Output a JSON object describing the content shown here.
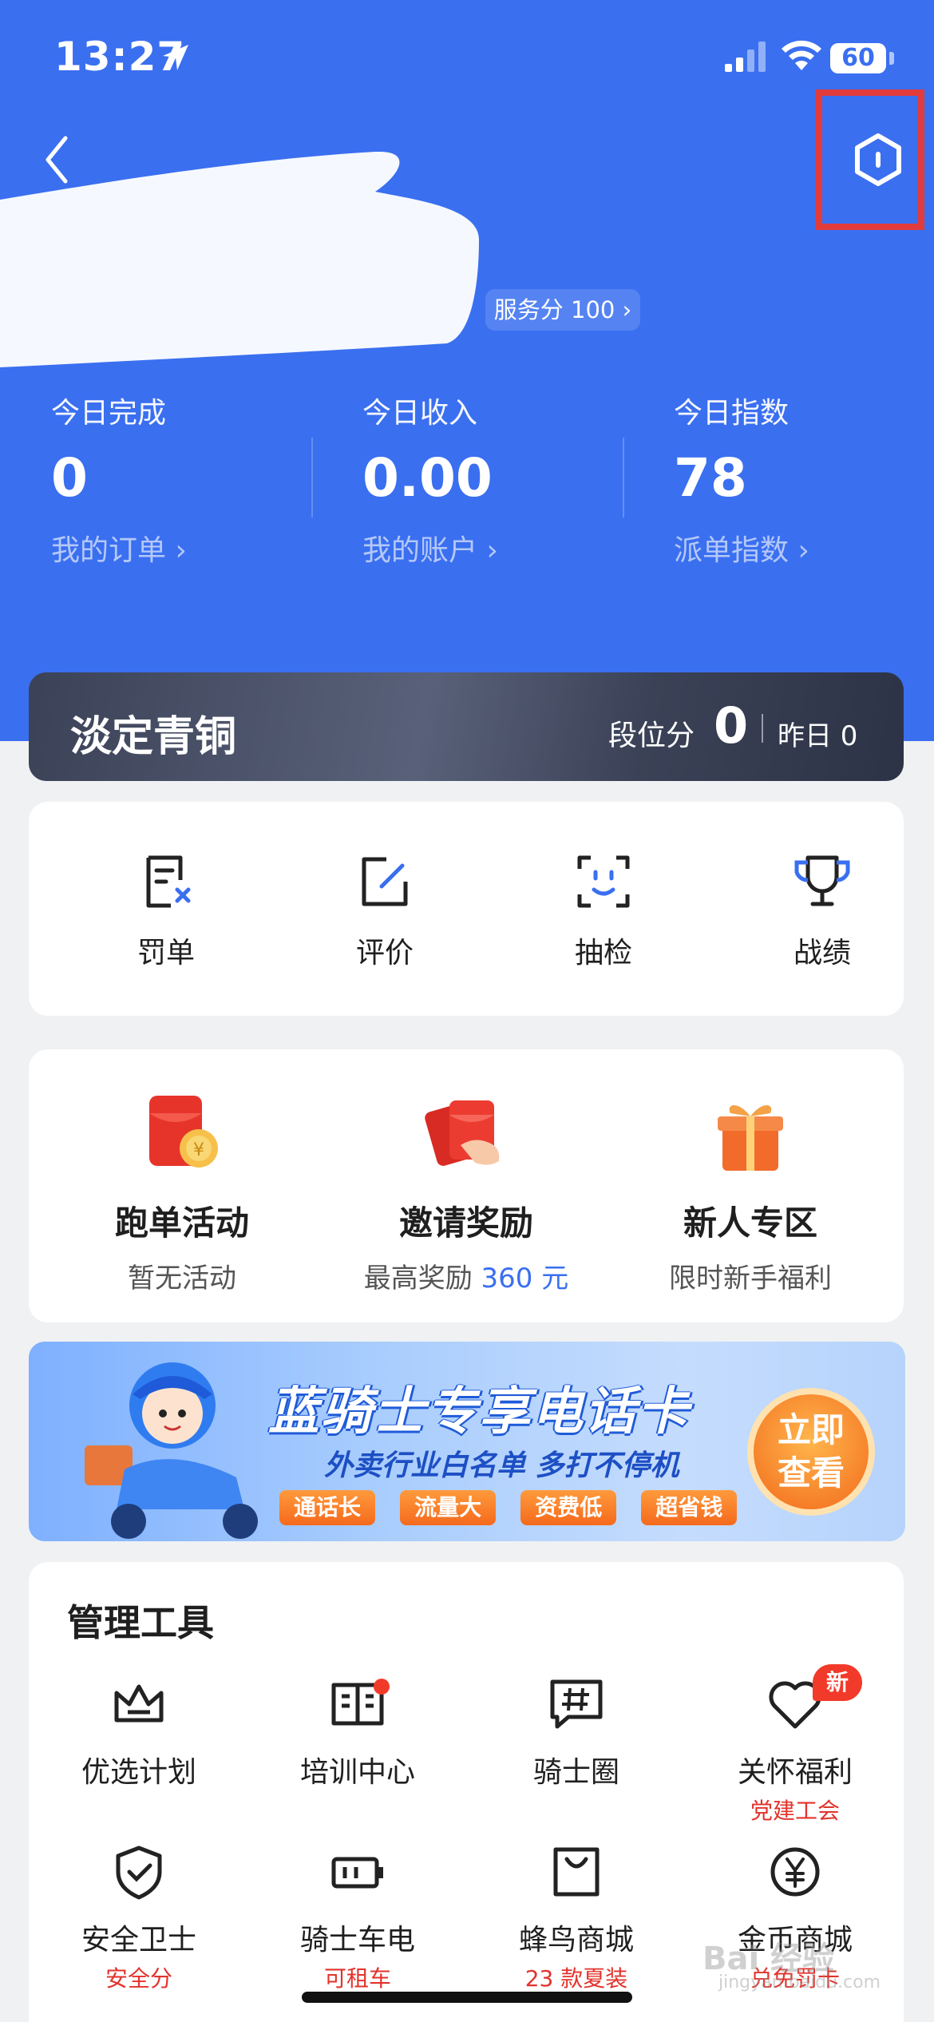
{
  "status_bar": {
    "time": "13:27",
    "battery": "60"
  },
  "header": {
    "service_score": "服务分 100"
  },
  "stats": [
    {
      "label": "今日完成",
      "value": "0",
      "link": "我的订单"
    },
    {
      "label": "今日收入",
      "value": "0.00",
      "link": "我的账户"
    },
    {
      "label": "今日指数",
      "value": "78",
      "link": "派单指数"
    }
  ],
  "rank": {
    "title": "淡定青铜",
    "score_label": "段位分",
    "score": "0",
    "yesterday": "昨日 0"
  },
  "quick_actions": [
    "罚单",
    "评价",
    "抽检",
    "战绩"
  ],
  "promos": [
    {
      "title": "跑单活动",
      "sub": "暂无活动",
      "accent": ""
    },
    {
      "title": "邀请奖励",
      "sub": "最高奖励 ",
      "accent": "360 元"
    },
    {
      "title": "新人专区",
      "sub": "限时新手福利",
      "accent": ""
    }
  ],
  "banner": {
    "title": "蓝骑士专享电话卡",
    "subtitle": "外卖行业白名单 多打不停机",
    "tags": [
      "通话长",
      "流量大",
      "资费低",
      "超省钱"
    ],
    "cta_line1": "立即",
    "cta_line2": "查看"
  },
  "tools": {
    "title": "管理工具",
    "items": [
      {
        "label": "优选计划",
        "sub": "",
        "icon": "crown-icon"
      },
      {
        "label": "培训中心",
        "sub": "",
        "icon": "book-icon"
      },
      {
        "label": "骑士圈",
        "sub": "",
        "icon": "hashtag-chat-icon"
      },
      {
        "label": "关怀福利",
        "sub": "党建工会",
        "icon": "heart-icon",
        "badge": "新"
      },
      {
        "label": "安全卫士",
        "sub": "安全分",
        "icon": "shield-icon"
      },
      {
        "label": "骑士车电",
        "sub": "可租车",
        "icon": "battery-icon"
      },
      {
        "label": "蜂鸟商城",
        "sub": "23 款夏装",
        "icon": "shopping-bag-icon"
      },
      {
        "label": "金币商城",
        "sub": "兑免罚卡",
        "icon": "yuan-coin-icon"
      }
    ]
  },
  "watermark": {
    "text": "Bai 经验",
    "url_text": "jingyan.baidu.com"
  }
}
